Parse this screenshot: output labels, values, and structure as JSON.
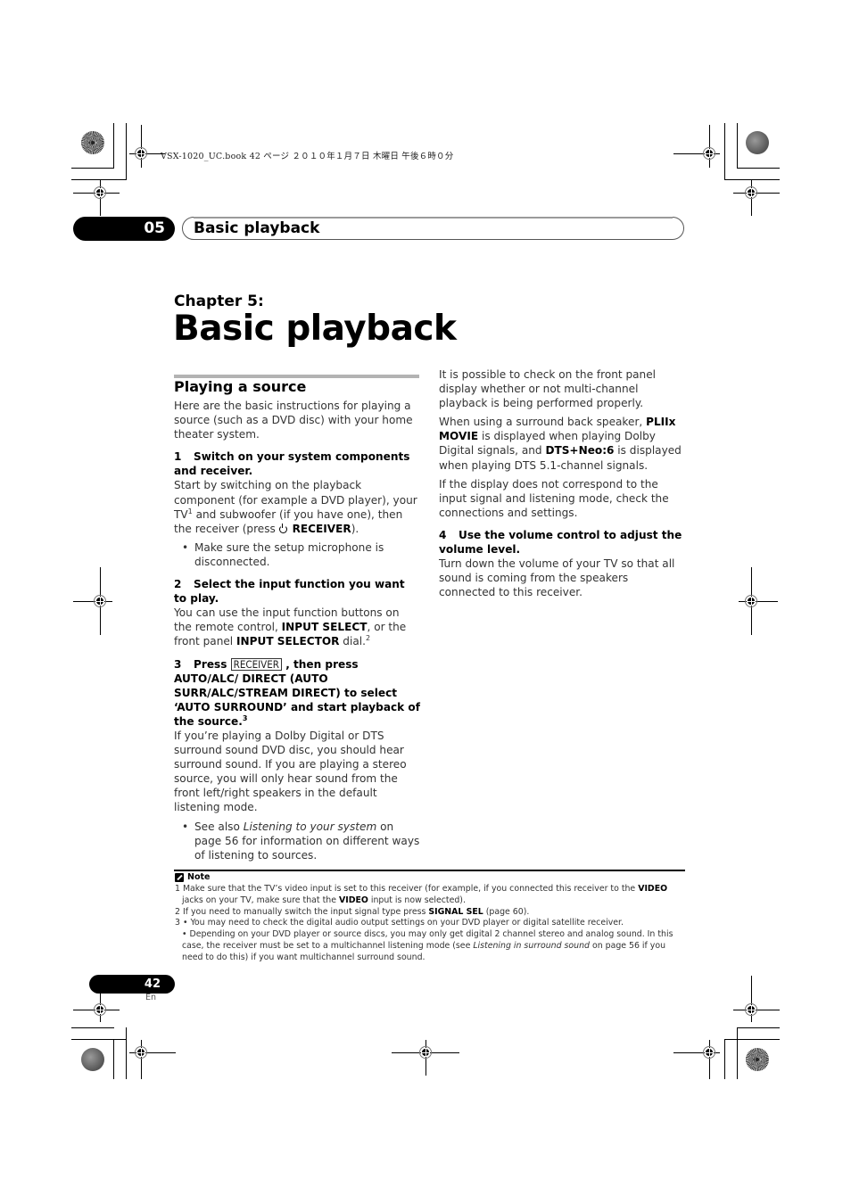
{
  "print_header": {
    "meta": "VSX-1020_UC.book  42 ページ  ２０１０年１月７日  木曜日  午後６時０分"
  },
  "chapter_tab": {
    "number": "05",
    "title": "Basic playback"
  },
  "chapter": {
    "label": "Chapter 5:",
    "title": "Basic playback"
  },
  "section": {
    "title": "Playing a source",
    "intro": "Here are the basic instructions for playing a source (such as a DVD disc) with your home theater system."
  },
  "steps": [
    {
      "num": "1",
      "heading": "Switch on your system components and receiver.",
      "body_a": "Start by switching on the playback component (for example a DVD player), your TV",
      "body_sup": "1",
      "body_b": " and subwoofer (if you have one), then the receiver (press ",
      "body_key": "RECEIVER",
      "body_c": ").",
      "bullet": "Make sure the setup microphone is disconnected."
    },
    {
      "num": "2",
      "heading": "Select the input function you want to play.",
      "body_a": "You can use the input function buttons on the remote control, ",
      "body_key1": "INPUT SELECT",
      "body_b": ", or the front panel ",
      "body_key2": "INPUT SELECTOR",
      "body_c": " dial.",
      "body_sup": "2"
    },
    {
      "num": "3",
      "heading_a": "Press ",
      "heading_key": "RECEIVER",
      "heading_b": " , then press AUTO/ALC/ DIRECT (AUTO SURR/ALC/STREAM DIRECT) to select ‘AUTO SURROUND’ and start playback of the source.",
      "heading_sup": "3",
      "body": "If you’re playing a Dolby Digital or DTS surround sound DVD disc, you should hear surround sound. If you are playing a stereo source, you will only hear sound from the front left/right speakers in the default listening mode.",
      "bullet_a": "See also ",
      "bullet_italic": "Listening to your system",
      "bullet_b": " on page 56 for information on different ways of listening to sources."
    },
    {
      "num": "4",
      "heading": "Use the volume control to adjust the volume level.",
      "body": "Turn down the volume of your TV so that all sound is coming from the speakers connected to this receiver."
    }
  ],
  "right_col": {
    "p1": "It is possible to check on the front panel display whether or not multi-channel playback is being performed properly.",
    "p2_a": "When using a surround back speaker, ",
    "p2_key1": "PLIIx MOVIE",
    "p2_b": " is displayed when playing Dolby Digital signals, and ",
    "p2_key2": "DTS+Neo:6",
    "p2_c": " is displayed when playing DTS 5.1-channel signals.",
    "p3": "If the display does not correspond to the input signal and listening mode, check the connections and settings."
  },
  "notes": {
    "heading": "Note",
    "n1_a": "1 Make sure that the TV’s video input is set to this receiver (for example, if you connected this receiver to the ",
    "n1_key": "VIDEO",
    "n1_b": "jacks on your TV, make sure that the ",
    "n1_key2": "VIDEO",
    "n1_c": " input is now selected).",
    "n2_a": "2 If you need to manually switch the input signal type press ",
    "n2_key": "SIGNAL SEL",
    "n2_b": " (page 60).",
    "n3_a": "3 • You may need to check the digital audio output settings on your DVD player or digital satellite receiver.",
    "n3_b": "• Depending on your DVD player or source discs, you may only get digital 2 channel stereo and analog sound. In this",
    "n3_c_a": "case, the receiver must be set to a multichannel listening mode (see ",
    "n3_c_italic": "Listening in surround sound",
    "n3_c_b": " on page 56 if you",
    "n3_d": "need to do this) if you want multichannel surround sound."
  },
  "footer": {
    "page": "42",
    "lang": "En"
  }
}
